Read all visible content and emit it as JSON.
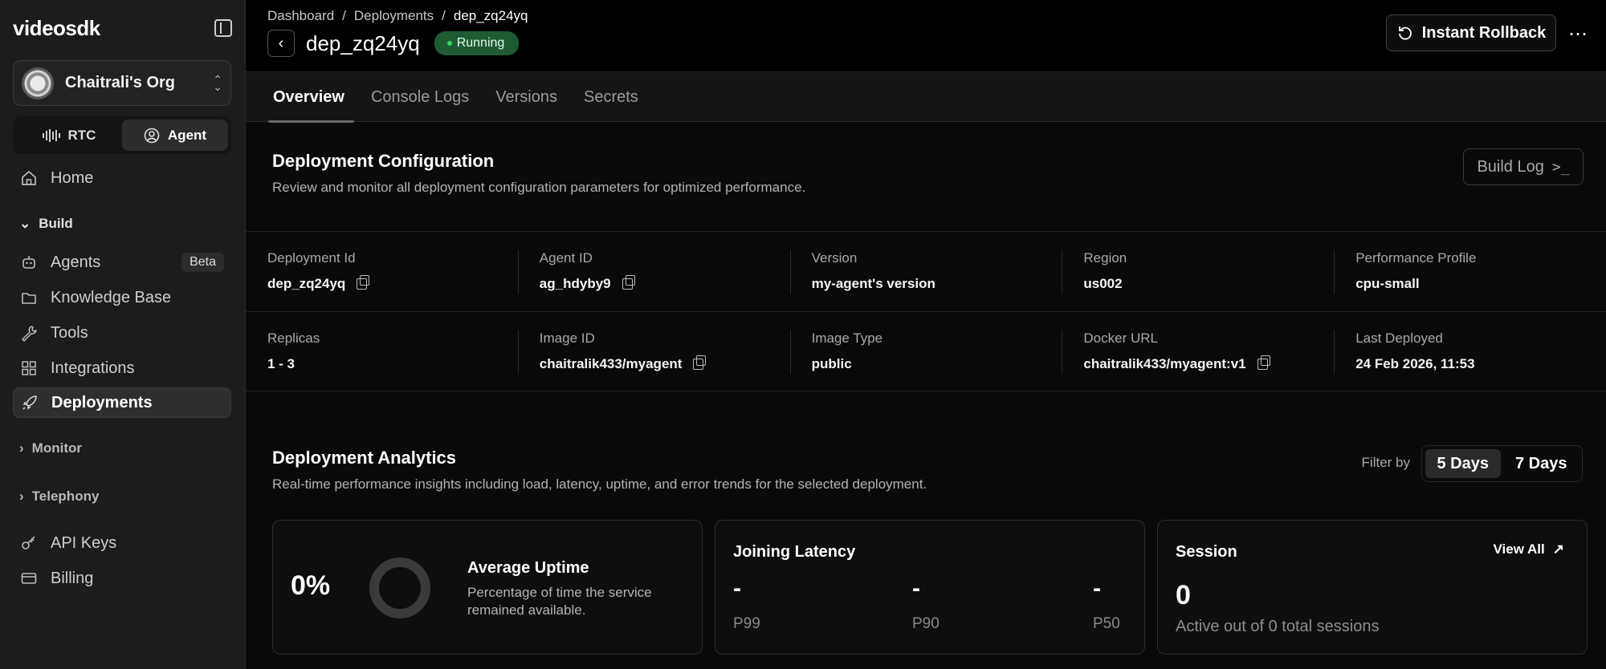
{
  "sidebar": {
    "logo": "videosdk",
    "org_name": "Chaitrali's Org",
    "switch": {
      "rtc": "RTC",
      "agent": "Agent"
    },
    "home": "Home",
    "build_section": "Build",
    "agents": "Agents",
    "agents_badge": "Beta",
    "knowledge_base": "Knowledge Base",
    "tools": "Tools",
    "integrations": "Integrations",
    "deployments": "Deployments",
    "monitor_section": "Monitor",
    "telephony_section": "Telephony",
    "api_keys": "API Keys",
    "billing": "Billing"
  },
  "header": {
    "breadcrumb": [
      "Dashboard",
      "Deployments",
      "dep_zq24yq"
    ],
    "title": "dep_zq24yq",
    "status": "Running",
    "rollback_label": "Instant Rollback",
    "more_label": "⋯"
  },
  "tabs": [
    "Overview",
    "Console Logs",
    "Versions",
    "Secrets"
  ],
  "config": {
    "title": "Deployment Configuration",
    "subtitle": "Review and monitor all deployment configuration parameters for optimized performance.",
    "build_log_label": "Build Log",
    "row1": [
      {
        "label": "Deployment Id",
        "value": "dep_zq24yq"
      },
      {
        "label": "Agent ID",
        "value": "ag_hdyby9"
      },
      {
        "label": "Version",
        "value": "my-agent's version"
      },
      {
        "label": "Region",
        "value": "us002"
      },
      {
        "label": "Performance Profile",
        "value": "cpu-small"
      }
    ],
    "row2": [
      {
        "label": "Replicas",
        "value": "1 - 3"
      },
      {
        "label": "Image ID",
        "value": "chaitralik433/myagent"
      },
      {
        "label": "Image Type",
        "value": "public"
      },
      {
        "label": "Docker URL",
        "value": "chaitralik433/myagent:v1"
      },
      {
        "label": "Last Deployed",
        "value": "24 Feb 2026, 11:53"
      }
    ]
  },
  "analytics": {
    "title": "Deployment Analytics",
    "subtitle": "Real-time performance insights including load, latency, uptime, and error trends for the selected deployment.",
    "filter_label": "Filter by",
    "filter_options": [
      "5 Days",
      "7 Days"
    ],
    "filter_selected": "5 Days",
    "uptime": {
      "value": "0%",
      "title": "Average Uptime",
      "desc_line1": "Percentage of time the service",
      "desc_line2": "remained available."
    },
    "latency": {
      "title": "Joining Latency",
      "p99_value": "-",
      "p99_label": "P99",
      "p90_value": "-",
      "p90_label": "P90",
      "p50_value": "-",
      "p50_label": "P50"
    },
    "session": {
      "title": "Session",
      "view_all": "View All",
      "value": "0",
      "desc": "Active out of 0 total sessions"
    }
  }
}
